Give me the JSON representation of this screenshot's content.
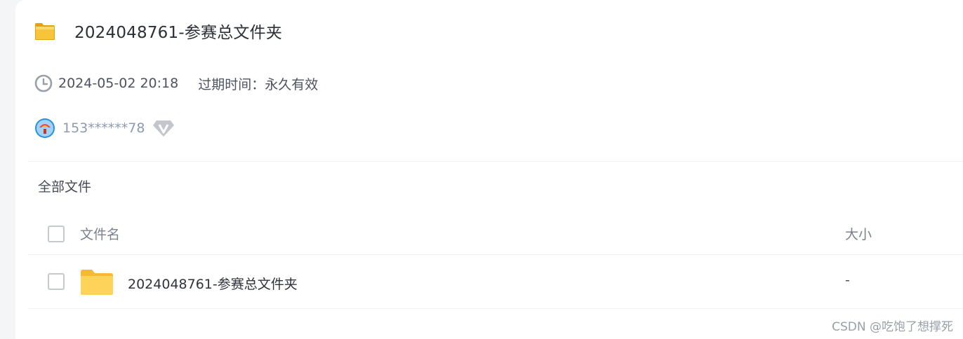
{
  "share": {
    "title": "2024048761-参赛总文件夹",
    "created_time": "2024-05-02 20:18",
    "expiry": "过期时间：永久有效",
    "user_name": "153******78"
  },
  "breadcrumb": {
    "label": "全部文件"
  },
  "table": {
    "columns": {
      "name": "文件名",
      "size": "大小"
    },
    "rows": [
      {
        "name": "2024048761-参赛总文件夹",
        "size": "-",
        "type": "folder"
      }
    ]
  },
  "watermark": "CSDN @吃饱了想撑死",
  "colors": {
    "folder_yellow": "#fdd35a",
    "text_primary": "#2b2f36",
    "text_muted": "#8d9bb0"
  }
}
